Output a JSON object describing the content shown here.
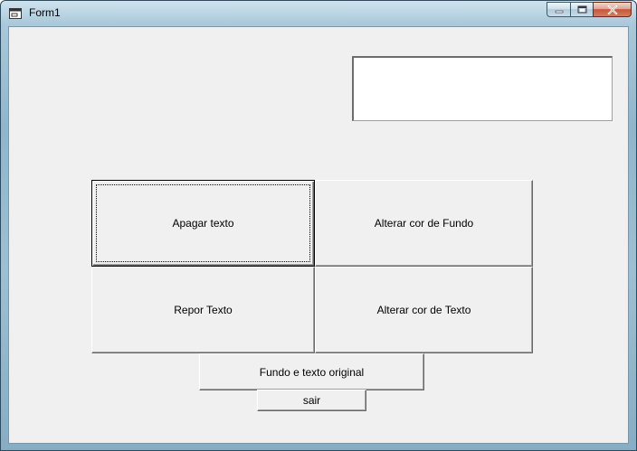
{
  "window": {
    "title": "Form1",
    "icon": "form-icon",
    "caption_buttons": [
      "minimize-icon",
      "maximize-icon",
      "close-icon"
    ]
  },
  "textbox": {
    "value": ""
  },
  "buttons": {
    "apagar": "Apagar texto",
    "alterar_fundo": "Alterar cor de Fundo",
    "repor": "Repor Texto",
    "alterar_texto": "Alterar cor de Texto",
    "original": "Fundo e texto original",
    "sair": "sair"
  },
  "colors": {
    "form_background": "#f0f0f0",
    "textbox_background": "#ffffff",
    "frame": "#9cc0d3"
  }
}
